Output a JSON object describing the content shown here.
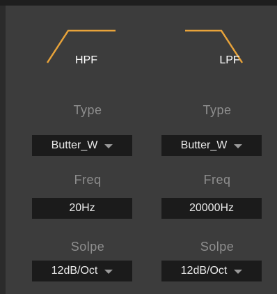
{
  "filters": [
    {
      "title": "HPF",
      "type_label": "Type",
      "type_value": "Butter_W",
      "freq_label": "Freq",
      "freq_value": "20Hz",
      "slope_label": "Solpe",
      "slope_value": "12dB/Oct"
    },
    {
      "title": "LPF",
      "type_label": "Type",
      "type_value": "Butter_W",
      "freq_label": "Freq",
      "freq_value": "20000Hz",
      "slope_label": "Solpe",
      "slope_value": "12dB/Oct"
    }
  ],
  "colors": {
    "curve": "#e8a33a",
    "panel": "#3c3c3c",
    "field": "#1b1b1b"
  },
  "icons": [
    "highpass-curve-icon",
    "lowpass-curve-icon",
    "chevron-down-icon"
  ]
}
